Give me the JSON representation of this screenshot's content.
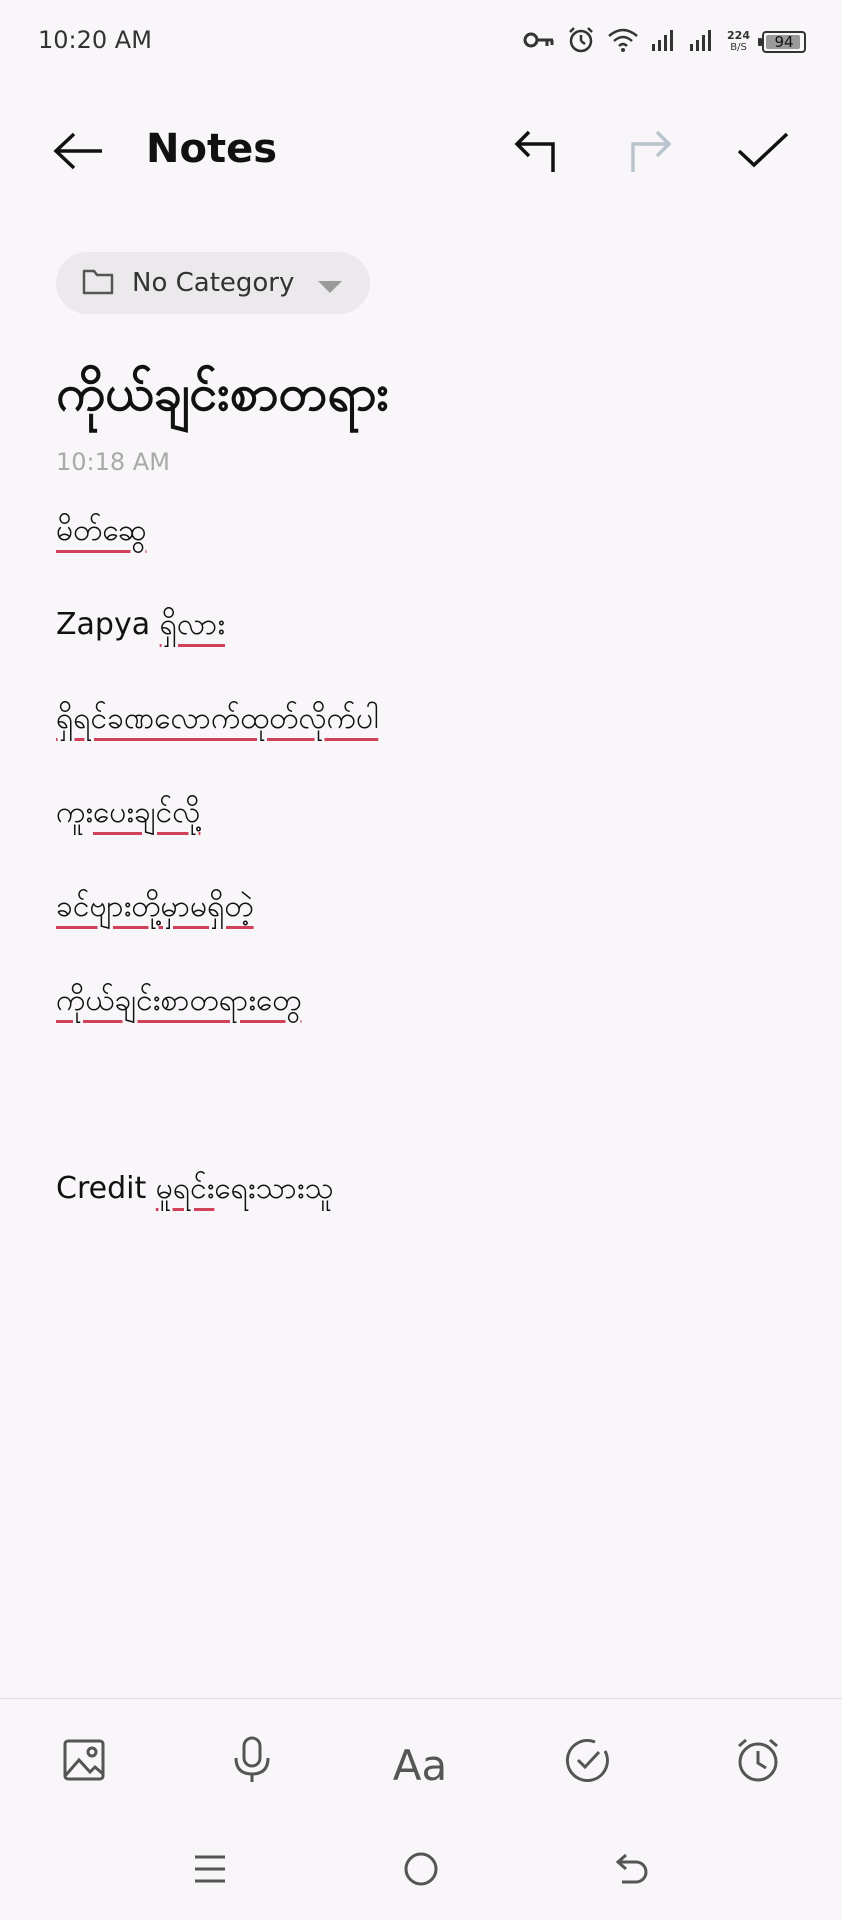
{
  "status_bar": {
    "time": "10:20 AM",
    "net_speed_value": "224",
    "net_speed_unit": "B/S",
    "battery_level": "94",
    "icons": [
      "key-icon",
      "alarm-icon",
      "wifi-icon",
      "signal-icon",
      "signal-icon"
    ]
  },
  "toolbar": {
    "title": "Notes",
    "back_icon": "arrow-left-icon",
    "undo_icon": "undo-icon",
    "redo_icon": "redo-icon",
    "done_icon": "check-icon"
  },
  "category": {
    "label": "No Category",
    "icon": "folder-icon"
  },
  "note": {
    "title": "ကိုယ်ချင်းစာတရား",
    "timestamp": "10:18 AM",
    "lines": [
      {
        "a": "",
        "b": "မိတ်ဆွေ"
      },
      {
        "a": "Zapya ",
        "b": "ရှိလား"
      },
      {
        "a": "",
        "b": "ရှိရင်ခဏလောက်ထုတ်လိုက်ပါ"
      },
      {
        "a": "ကူး",
        "b": "ပေးချင်လို့"
      },
      {
        "a": "",
        "b": "ခင်ဗျားတို့မှာမရှိတဲ့"
      },
      {
        "a": "",
        "b": "ကိုယ်ချင်းစာတရားတွေ"
      },
      {
        "a": "",
        "b": ""
      },
      {
        "a": "Credit ",
        "b": "မူရင်း",
        "c": "ရေးသားသူ"
      }
    ]
  },
  "bottom_toolbar": {
    "icons": [
      "image-icon",
      "microphone-icon",
      "text-format-icon",
      "checklist-icon",
      "reminder-icon"
    ],
    "text_format_label": "Aa"
  },
  "nav_bar": {
    "icons": [
      "menu-icon",
      "home-icon",
      "back-icon"
    ]
  },
  "colors": {
    "background": "#f8f6f9",
    "underline": "#d2415a",
    "redo_disabled": "#b9c3cc"
  }
}
